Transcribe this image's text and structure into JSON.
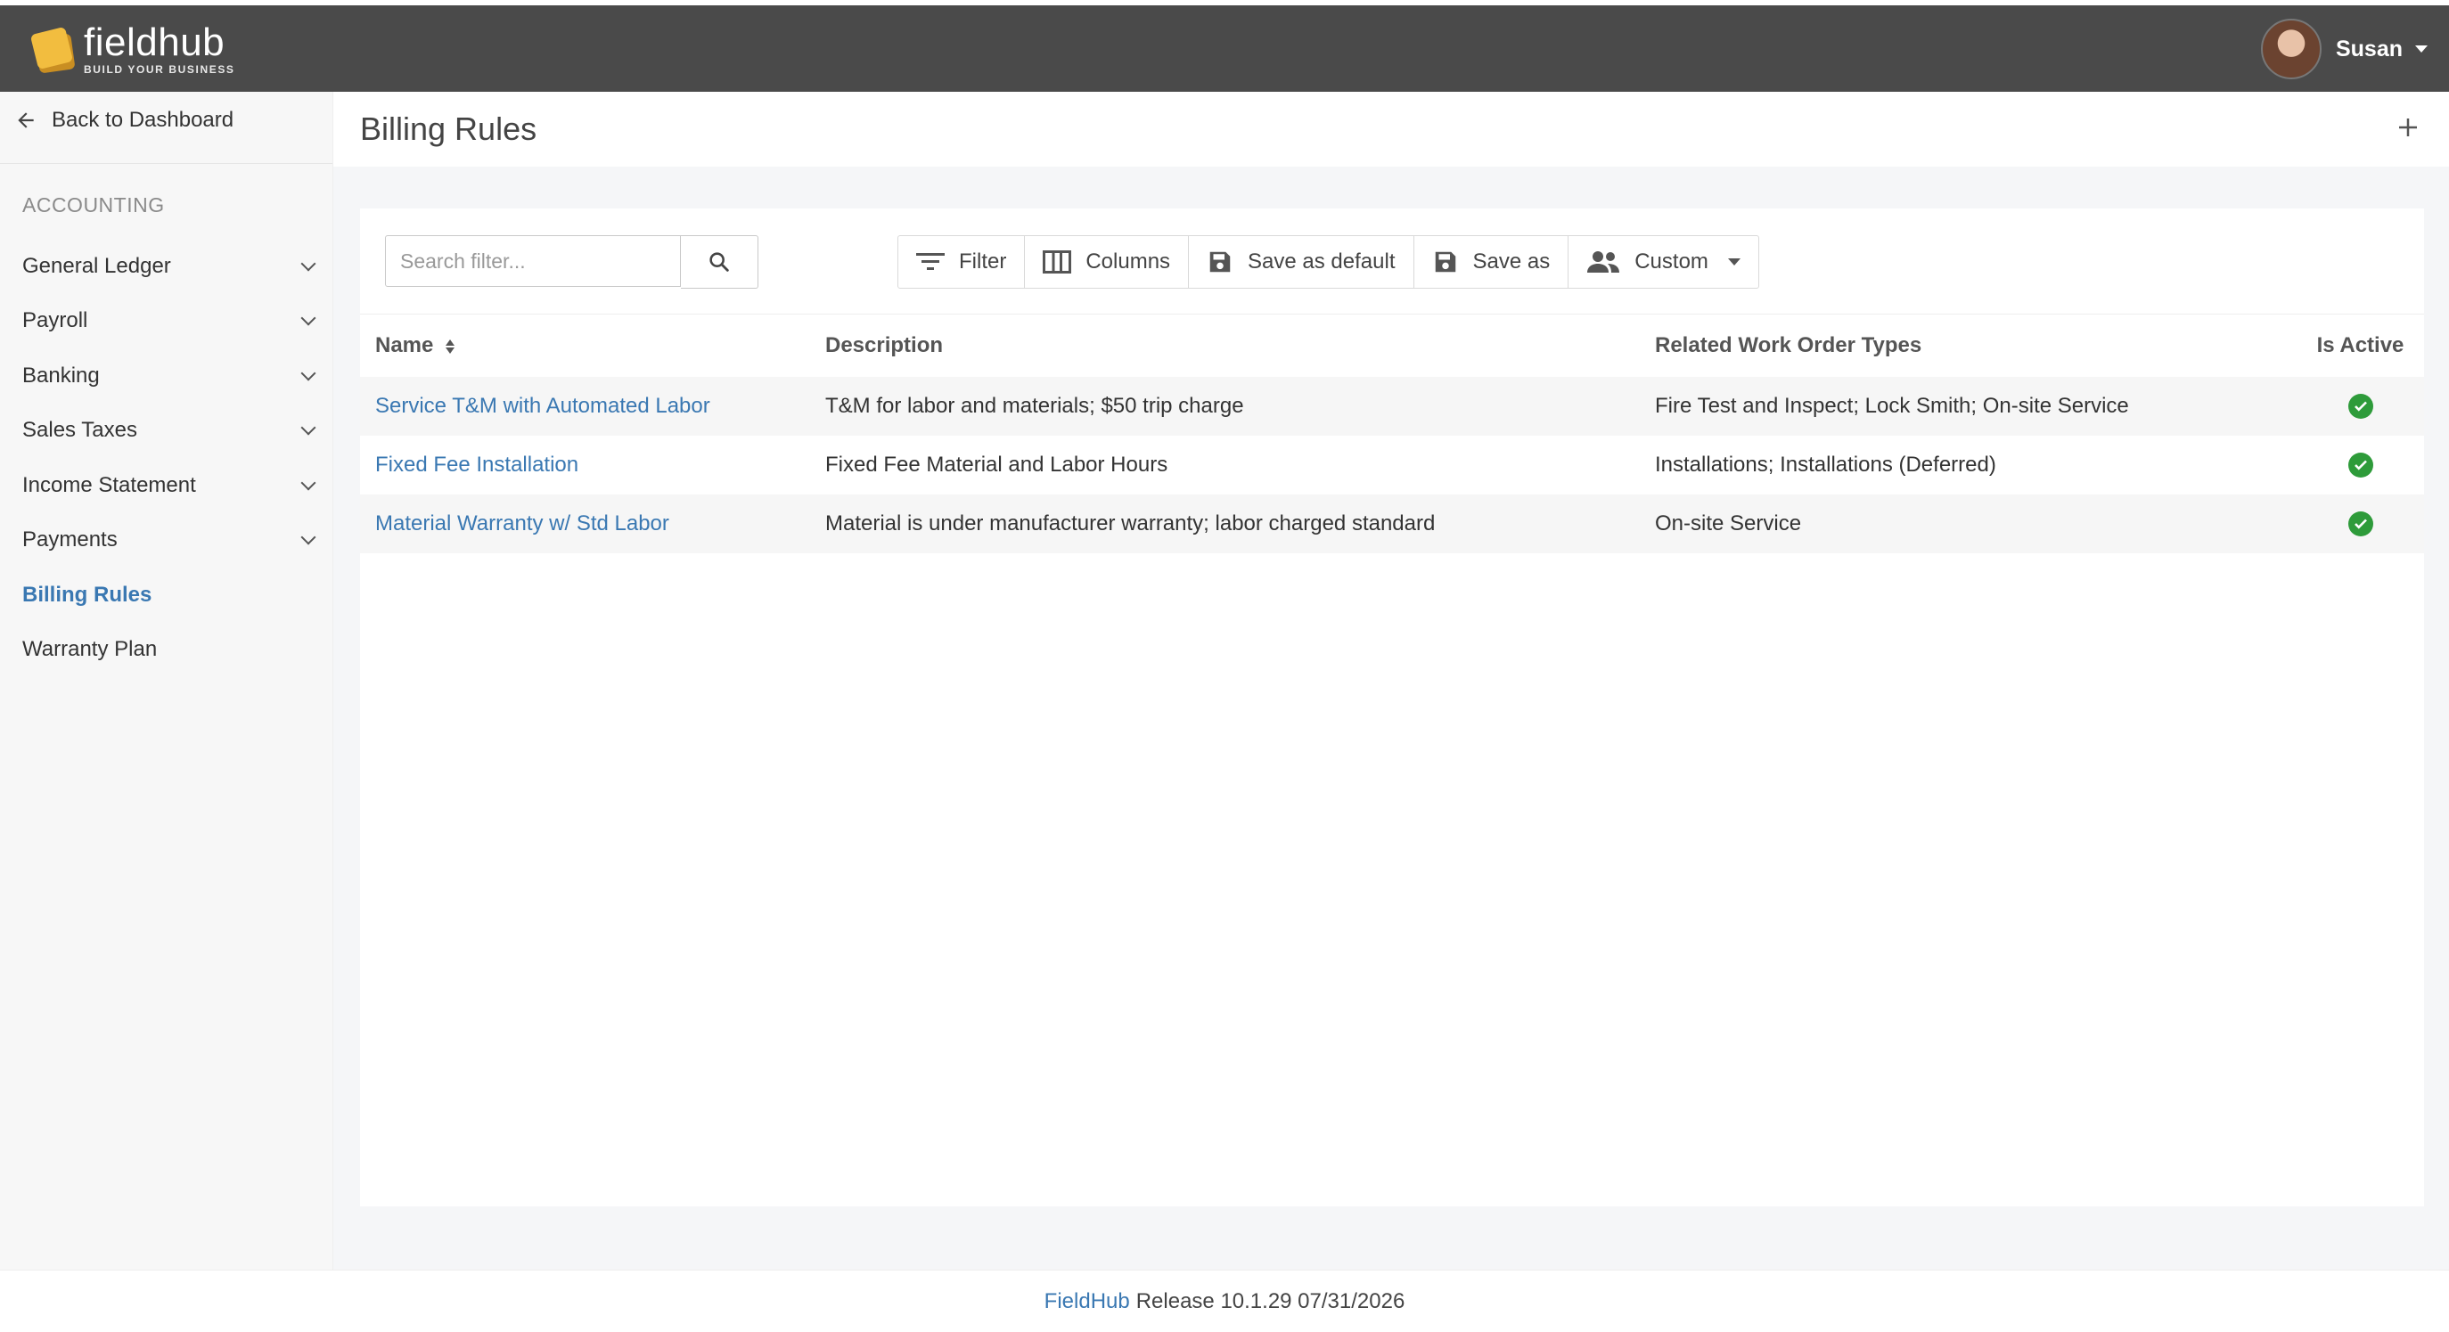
{
  "header": {
    "logo_name": "fieldhub",
    "logo_tagline": "BUILD YOUR BUSINESS",
    "user_name": "Susan"
  },
  "sidebar": {
    "back_label": "Back to Dashboard",
    "section_title": "ACCOUNTING",
    "items": [
      {
        "label": "General Ledger",
        "expandable": true
      },
      {
        "label": "Payroll",
        "expandable": true
      },
      {
        "label": "Banking",
        "expandable": true
      },
      {
        "label": "Sales Taxes",
        "expandable": true
      },
      {
        "label": "Income Statement",
        "expandable": true
      },
      {
        "label": "Payments",
        "expandable": true
      },
      {
        "label": "Billing Rules",
        "expandable": false,
        "active": true
      },
      {
        "label": "Warranty Plan",
        "expandable": false
      }
    ]
  },
  "page": {
    "title": "Billing Rules",
    "add_icon": "plus-icon"
  },
  "search": {
    "placeholder": "Search filter...",
    "value": ""
  },
  "toolbar": {
    "filter_label": "Filter",
    "columns_label": "Columns",
    "save_default_label": "Save as default",
    "save_as_label": "Save as",
    "custom_label": "Custom"
  },
  "table": {
    "columns": [
      "Name",
      "Description",
      "Related Work Order Types",
      "Is Active"
    ],
    "rows": [
      {
        "name": "Service T&M with Automated Labor",
        "description": "T&M for labor and materials; $50 trip charge",
        "types": "Fire Test and Inspect; Lock Smith; On-site Service",
        "active": true
      },
      {
        "name": "Fixed Fee Installation",
        "description": "Fixed Fee Material and Labor Hours",
        "types": "Installations; Installations (Deferred)",
        "active": true
      },
      {
        "name": "Material Warranty w/ Std Labor",
        "description": "Material is under manufacturer warranty; labor charged standard",
        "types": "On-site Service",
        "active": true
      }
    ]
  },
  "footer": {
    "brand": "FieldHub",
    "release": "Release 10.1.29 07/31/2026"
  },
  "colors": {
    "topbar": "#4a4a4a",
    "accent_link": "#3a78b2",
    "active_check": "#2e9b3a",
    "logo_yellow": "#f2bd3f"
  }
}
